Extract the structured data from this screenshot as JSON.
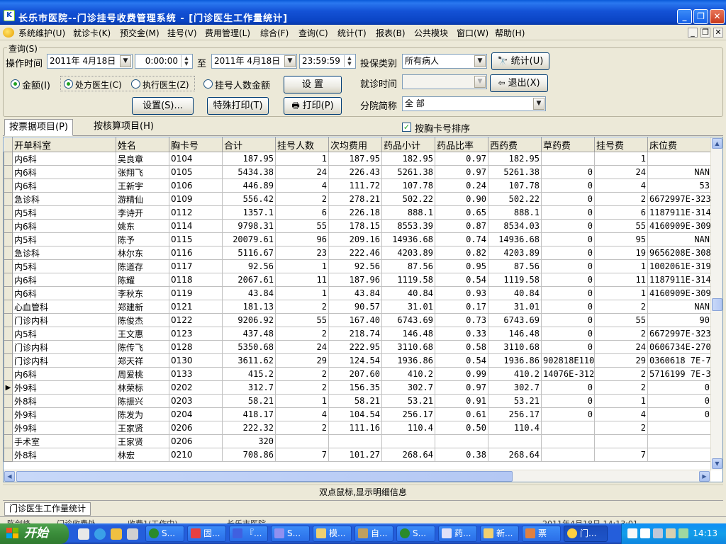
{
  "window": {
    "title": "长乐市医院--门诊挂号收费管理系统 - [门诊医生工作量统计]",
    "icon_letter": "K"
  },
  "menu": [
    "系统维护(U)",
    "就诊卡(K)",
    "预交金(M)",
    "挂号(V)",
    "费用管理(L)",
    "综合(F)",
    "查询(C)",
    "统计(T)",
    "报表(B)",
    "公共模块",
    "窗口(W)",
    "帮助(H)"
  ],
  "query": {
    "group_title": "查询(S)",
    "op_time_label": "操作时间",
    "date_from": "2011年 4月18日",
    "time_from": "0:00:00",
    "to_label": "至",
    "date_to": "2011年 4月18日",
    "time_to": "23:59:59",
    "insurance_label": "投保类别",
    "insurance_value": "所有病人",
    "visit_time_label": "就诊时间",
    "visit_time_value": "",
    "branch_label": "分院简称",
    "branch_value": "全 部",
    "radio_amount": "金额(I)",
    "radio_presc_doctor": "处方医生(C)",
    "radio_exec_doctor": "执行医生(Z)",
    "radio_reg_count": "挂号人数金额",
    "btn_setup": "设 置",
    "btn_settings": "设置(S)...",
    "btn_special_print": "特殊打印(T)",
    "btn_print": "打印(P)",
    "btn_stat": "统计(U)",
    "btn_exit": "退出(X)"
  },
  "tabs": [
    "按票据项目(P)",
    "按核算项目(H)"
  ],
  "sort_checkbox": "按胸卡号排序",
  "grid": {
    "columns": [
      "开单科室",
      "姓名",
      "胸卡号",
      "合计",
      "挂号人数",
      "次均费用",
      "药品小计",
      "药品比率",
      "西药费",
      "草药费",
      "挂号费",
      "床位费"
    ],
    "rows": [
      [
        "内6科",
        "吴良章",
        "0104",
        "187.95",
        "1",
        "187.95",
        "182.95",
        "0.97",
        "182.95",
        "",
        "1",
        ""
      ],
      [
        "内6科",
        "张翔飞",
        "0105",
        "5434.38",
        "24",
        "226.43",
        "5261.38",
        "0.97",
        "5261.38",
        "0",
        "24",
        "NAN"
      ],
      [
        "内6科",
        "王新宇",
        "0106",
        "446.89",
        "4",
        "111.72",
        "107.78",
        "0.24",
        "107.78",
        "0",
        "4",
        "53"
      ],
      [
        "急诊科",
        "游精仙",
        "0109",
        "556.42",
        "2",
        "278.21",
        "502.22",
        "0.90",
        "502.22",
        "0",
        "2",
        "6672997E-323"
      ],
      [
        "内5科",
        "李诗开",
        "0112",
        "1357.1",
        "6",
        "226.18",
        "888.1",
        "0.65",
        "888.1",
        "0",
        "6",
        "1187911E-314"
      ],
      [
        "内6科",
        "姚东",
        "0114",
        "9798.31",
        "55",
        "178.15",
        "8553.39",
        "0.87",
        "8534.03",
        "0",
        "55",
        "4160909E-309"
      ],
      [
        "内5科",
        "陈予",
        "0115",
        "20079.61",
        "96",
        "209.16",
        "14936.68",
        "0.74",
        "14936.68",
        "0",
        "95",
        "NAN"
      ],
      [
        "急诊科",
        "林尔东",
        "0116",
        "5116.67",
        "23",
        "222.46",
        "4203.89",
        "0.82",
        "4203.89",
        "0",
        "19",
        "9656208E-308"
      ],
      [
        "内5科",
        "陈道存",
        "0117",
        "92.56",
        "1",
        "92.56",
        "87.56",
        "0.95",
        "87.56",
        "0",
        "1",
        "1002061E-319"
      ],
      [
        "内6科",
        "陈耀",
        "0118",
        "2067.61",
        "11",
        "187.96",
        "1119.58",
        "0.54",
        "1119.58",
        "0",
        "11",
        "1187911E-314"
      ],
      [
        "内6科",
        "李秋东",
        "0119",
        "43.84",
        "1",
        "43.84",
        "40.84",
        "0.93",
        "40.84",
        "0",
        "1",
        "4160909E-309"
      ],
      [
        "心血管科",
        "郑建新",
        "0121",
        "181.13",
        "2",
        "90.57",
        "31.01",
        "0.17",
        "31.01",
        "0",
        "2",
        "NAN"
      ],
      [
        "门诊内科",
        "陈俊杰",
        "0122",
        "9206.92",
        "55",
        "167.40",
        "6743.69",
        "0.73",
        "6743.69",
        "0",
        "55",
        "90"
      ],
      [
        "内5科",
        "王文惠",
        "0123",
        "437.48",
        "2",
        "218.74",
        "146.48",
        "0.33",
        "146.48",
        "0",
        "2",
        "6672997E-323"
      ],
      [
        "门诊内科",
        "陈传飞",
        "0128",
        "5350.68",
        "24",
        "222.95",
        "3110.68",
        "0.58",
        "3110.68",
        "0",
        "24",
        "0606734E-270"
      ],
      [
        "门诊内科",
        "郑天祥",
        "0130",
        "3611.62",
        "29",
        "124.54",
        "1936.86",
        "0.54",
        "1936.86",
        "902818E110",
        "29",
        "0360618 7E-73"
      ],
      [
        "内6科",
        "周爱桃",
        "0133",
        "415.2",
        "2",
        "207.60",
        "410.2",
        "0.99",
        "410.2",
        "14076E-312",
        "2",
        "5716199 7E-317"
      ],
      [
        "外9科",
        "林荣标",
        "0202",
        "312.7",
        "2",
        "156.35",
        "302.7",
        "0.97",
        "302.7",
        "0",
        "2",
        "0"
      ],
      [
        "外8科",
        "陈振兴",
        "0203",
        "58.21",
        "1",
        "58.21",
        "53.21",
        "0.91",
        "53.21",
        "0",
        "1",
        "0"
      ],
      [
        "外9科",
        "陈发为",
        "0204",
        "418.17",
        "4",
        "104.54",
        "256.17",
        "0.61",
        "256.17",
        "0",
        "4",
        "0"
      ],
      [
        "外9科",
        "王家贤",
        "0206",
        "222.32",
        "2",
        "111.16",
        "110.4",
        "0.50",
        "110.4",
        "",
        "2",
        ""
      ],
      [
        "手术室",
        "王家贤",
        "0206",
        "320",
        "",
        "",
        "",
        "",
        "",
        "",
        "",
        ""
      ],
      [
        "外8科",
        "林宏",
        "0210",
        "708.86",
        "7",
        "101.27",
        "268.64",
        "0.38",
        "268.64",
        "",
        "7",
        ""
      ]
    ],
    "current_row": 17
  },
  "hint": "双点鼠标,显示明细信息",
  "mdi_tab": "门诊医生工作量统计",
  "status": [
    "陈剑峰",
    "门诊收费处",
    "收费1(工作中)",
    "长乐市医院",
    "2011年4月18日 14:13:01"
  ],
  "taskbar": {
    "start_label": "开始",
    "items": [
      "S...",
      "固...",
      "『...",
      "S...",
      "模...",
      "自...",
      "S...",
      "药...",
      "新...",
      "票",
      "门..."
    ],
    "clock": "14:13"
  },
  "colors": {
    "title_blue": "#0a44c4",
    "taskbar_blue": "#245edb",
    "start_green": "#3a8c3a",
    "face": "#ece9d8"
  }
}
